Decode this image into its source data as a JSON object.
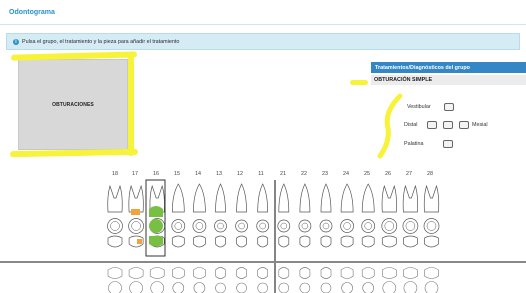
{
  "page": {
    "title": "Odontograma"
  },
  "info": {
    "icon": "info-icon",
    "text": "Pulsa el grupo, el tratamiento y la pieza para añadir el tratamiento"
  },
  "group": {
    "label": "OBTURACIONES"
  },
  "panel": {
    "header": "Tratamientos/Diagnósticos del grupo",
    "treatment": "OBTURACIÓN SIMPLE",
    "faces": {
      "vestibular": "Vestibular",
      "distal": "Distal",
      "mesial": "Mesial",
      "palatina": "Palatina"
    }
  },
  "odontogram": {
    "upper_teeth": [
      "18",
      "17",
      "16",
      "15",
      "14",
      "13",
      "12",
      "11",
      "21",
      "22",
      "23",
      "24",
      "25",
      "26",
      "27",
      "28"
    ],
    "selected_tooth": "16"
  },
  "colors": {
    "accent": "#2a93c9",
    "header_blue": "#3487c4",
    "treatment_green": "#77c043",
    "marker_orange": "#f0a43a",
    "highlight_yellow": "#f6f33a"
  }
}
